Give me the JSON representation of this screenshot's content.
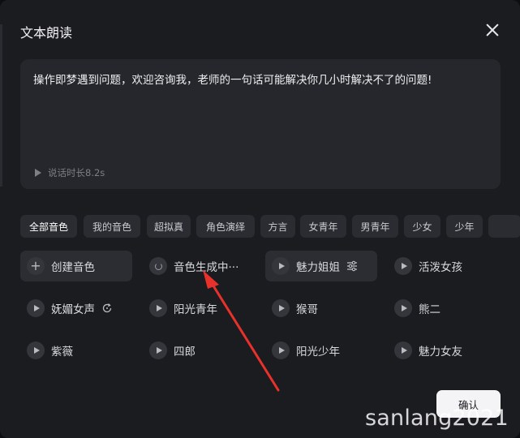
{
  "dialog": {
    "title": "文本朗读",
    "close_icon": "close-icon"
  },
  "textbox": {
    "content": "操作即梦遇到问题，欢迎咨询我，老师的一句话可能解决你几小时解决不了的问题!",
    "duration_label": "说话时长8.2s"
  },
  "tabs": [
    {
      "label": "全部音色",
      "active": true
    },
    {
      "label": "我的音色"
    },
    {
      "label": "超拟真"
    },
    {
      "label": "角色演绎"
    },
    {
      "label": "方言"
    },
    {
      "label": "女青年"
    },
    {
      "label": "男青年"
    },
    {
      "label": "少女"
    },
    {
      "label": "少年"
    }
  ],
  "voices": [
    {
      "label": "创建音色",
      "icon": "plus-icon"
    },
    {
      "label": "音色生成中···",
      "icon": "loading-icon"
    },
    {
      "label": "魅力姐姐",
      "icon": "play-icon",
      "suffix_icon": "settings-sliders-icon"
    },
    {
      "label": "活泼女孩",
      "icon": "play-icon"
    },
    {
      "label": "妩媚女声",
      "icon": "play-icon",
      "suffix_icon": "refresh-icon"
    },
    {
      "label": "阳光青年",
      "icon": "play-icon"
    },
    {
      "label": "猴哥",
      "icon": "play-icon"
    },
    {
      "label": "熊二",
      "icon": "play-icon"
    },
    {
      "label": "紫薇",
      "icon": "play-icon"
    },
    {
      "label": "四郎",
      "icon": "play-icon"
    },
    {
      "label": "阳光少年",
      "icon": "play-icon"
    },
    {
      "label": "魅力女友",
      "icon": "play-icon"
    }
  ],
  "confirm_label": "确认",
  "watermark": "sanlang2021",
  "colors": {
    "dialog_bg": "#1b1c20",
    "textbox_bg": "#25272c",
    "chip_bg": "#2a2c31",
    "annotation_arrow": "#e8312b"
  }
}
